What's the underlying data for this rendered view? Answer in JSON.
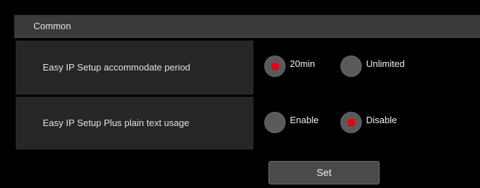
{
  "section": {
    "title": "Common"
  },
  "settings": [
    {
      "label": "Easy IP Setup accommodate period",
      "options": [
        {
          "label": "20min",
          "selected": true
        },
        {
          "label": "Unlimited",
          "selected": false
        }
      ]
    },
    {
      "label": "Easy IP Setup Plus plain text usage",
      "options": [
        {
          "label": "Enable",
          "selected": false
        },
        {
          "label": "Disable",
          "selected": true
        }
      ]
    }
  ],
  "actions": {
    "set_label": "Set"
  },
  "colors": {
    "background": "#000000",
    "header_bg": "#3a3a3a",
    "row_bg": "#262626",
    "radio_bg": "#5a5a5a",
    "radio_selected_dot": "#e60012",
    "button_bg": "#4a4a4a"
  }
}
